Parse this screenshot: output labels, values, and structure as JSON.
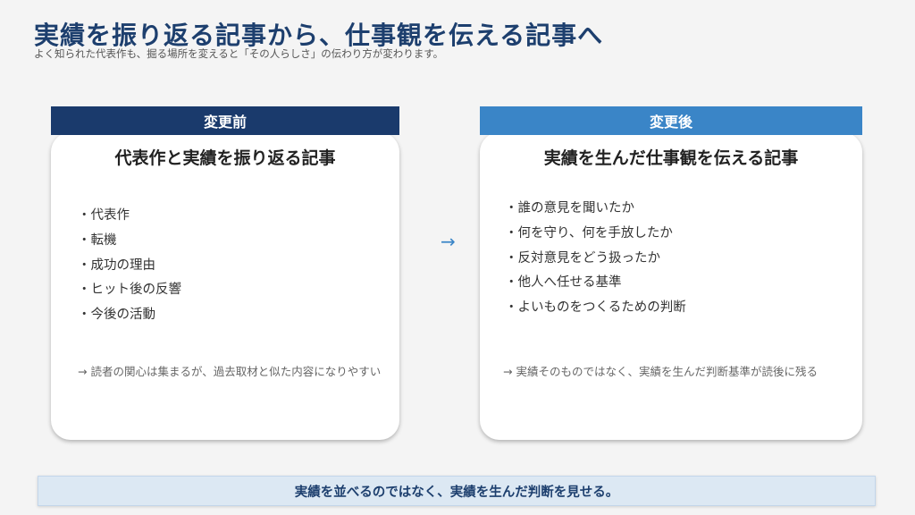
{
  "slide": {
    "title": "実績を振り返る記事から、仕事観を伝える記事へ",
    "subtitle": "よく知られた代表作も、掘る場所を変えると「その人らしさ」の伝わり方が変わります。"
  },
  "before": {
    "header": "変更前",
    "title": "代表作と実績を振り返る記事",
    "items": [
      "・代表作",
      "・転機",
      "・成功の理由",
      "・ヒット後の反響",
      "・今後の活動"
    ],
    "note": "→ 読者の関心は集まるが、過去取材と似た内容になりやすい"
  },
  "after": {
    "header": "変更後",
    "title": "実績を生んだ仕事観を伝える記事",
    "items": [
      "・誰の意見を聞いたか",
      "・何を守り、何を手放したか",
      "・反対意見をどう扱ったか",
      "・他人へ任せる基準",
      "・よいものをつくるための判断"
    ],
    "note": "→ 実績そのものではなく、実績を生んだ判断基準が読後に残る"
  },
  "arrow": "→",
  "banner": "実績を並べるのではなく、実績を生んだ判断を見せる。",
  "colors": {
    "title": "#1d3f6e",
    "before_header": "#1a3a6c",
    "after_header": "#3a85c7",
    "banner_bg": "#dce8f3"
  }
}
